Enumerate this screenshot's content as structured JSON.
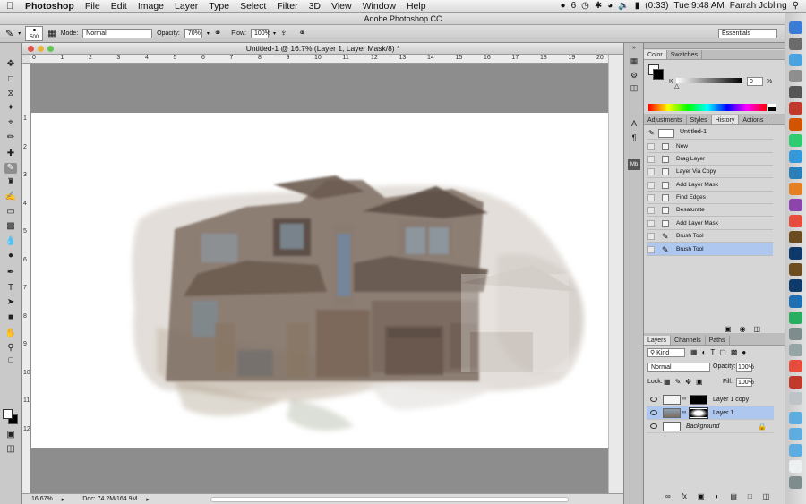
{
  "menubar": {
    "app_name": "Photoshop",
    "menus": [
      "File",
      "Edit",
      "Image",
      "Layer",
      "Type",
      "Select",
      "Filter",
      "3D",
      "View",
      "Window",
      "Help"
    ],
    "status": {
      "badge": "6",
      "battery": "(0:33)",
      "clock": "Tue 9:48 AM",
      "user": "Farrah Jobling"
    }
  },
  "app_title": "Adobe Photoshop CC",
  "options_bar": {
    "brush_size": "500",
    "mode_label": "Mode:",
    "mode_value": "Normal",
    "opacity_label": "Opacity:",
    "opacity_value": "70%",
    "flow_label": "Flow:",
    "flow_value": "100%",
    "workspace": "Essentials"
  },
  "document": {
    "title": "Untitled-1 @ 16.7% (Layer 1, Layer Mask/8) *",
    "ruler_ticks": [
      "0",
      "1",
      "2",
      "3",
      "4",
      "5",
      "6",
      "7",
      "8",
      "9",
      "10",
      "11",
      "12",
      "13",
      "14",
      "15",
      "16",
      "17",
      "18",
      "19",
      "20"
    ],
    "vruler_ticks": [
      "1",
      "2",
      "3",
      "4",
      "5",
      "6",
      "7",
      "8",
      "9",
      "10",
      "11",
      "12"
    ],
    "zoom": "16.67%",
    "doc_info": "Doc: 74.2M/164.9M"
  },
  "color_panel": {
    "tabs": [
      "Color",
      "Swatches"
    ],
    "channel": "K",
    "value": "0",
    "unit": "%"
  },
  "history_panel": {
    "tabs": [
      "Adjustments",
      "Styles",
      "History",
      "Actions"
    ],
    "snapshot": "Untitled-1",
    "items": [
      "New",
      "Drag Layer",
      "Layer Via Copy",
      "Add Layer Mask",
      "Find Edges",
      "Desaturate",
      "Add Layer Mask",
      "Brush Tool",
      "Brush Tool"
    ]
  },
  "layers_panel": {
    "tabs": [
      "Layers",
      "Channels",
      "Paths"
    ],
    "kind": "Kind",
    "blend_mode": "Normal",
    "opacity_label": "Opacity:",
    "opacity_value": "100%",
    "lock_label": "Lock:",
    "fill_label": "Fill:",
    "fill_value": "100%",
    "layers": [
      "Layer 1 copy",
      "Layer 1",
      "Background"
    ]
  },
  "colors": {
    "selection": "#aec7ee",
    "panel": "#d6d6d6",
    "pasteboard": "#8d8d8d"
  }
}
